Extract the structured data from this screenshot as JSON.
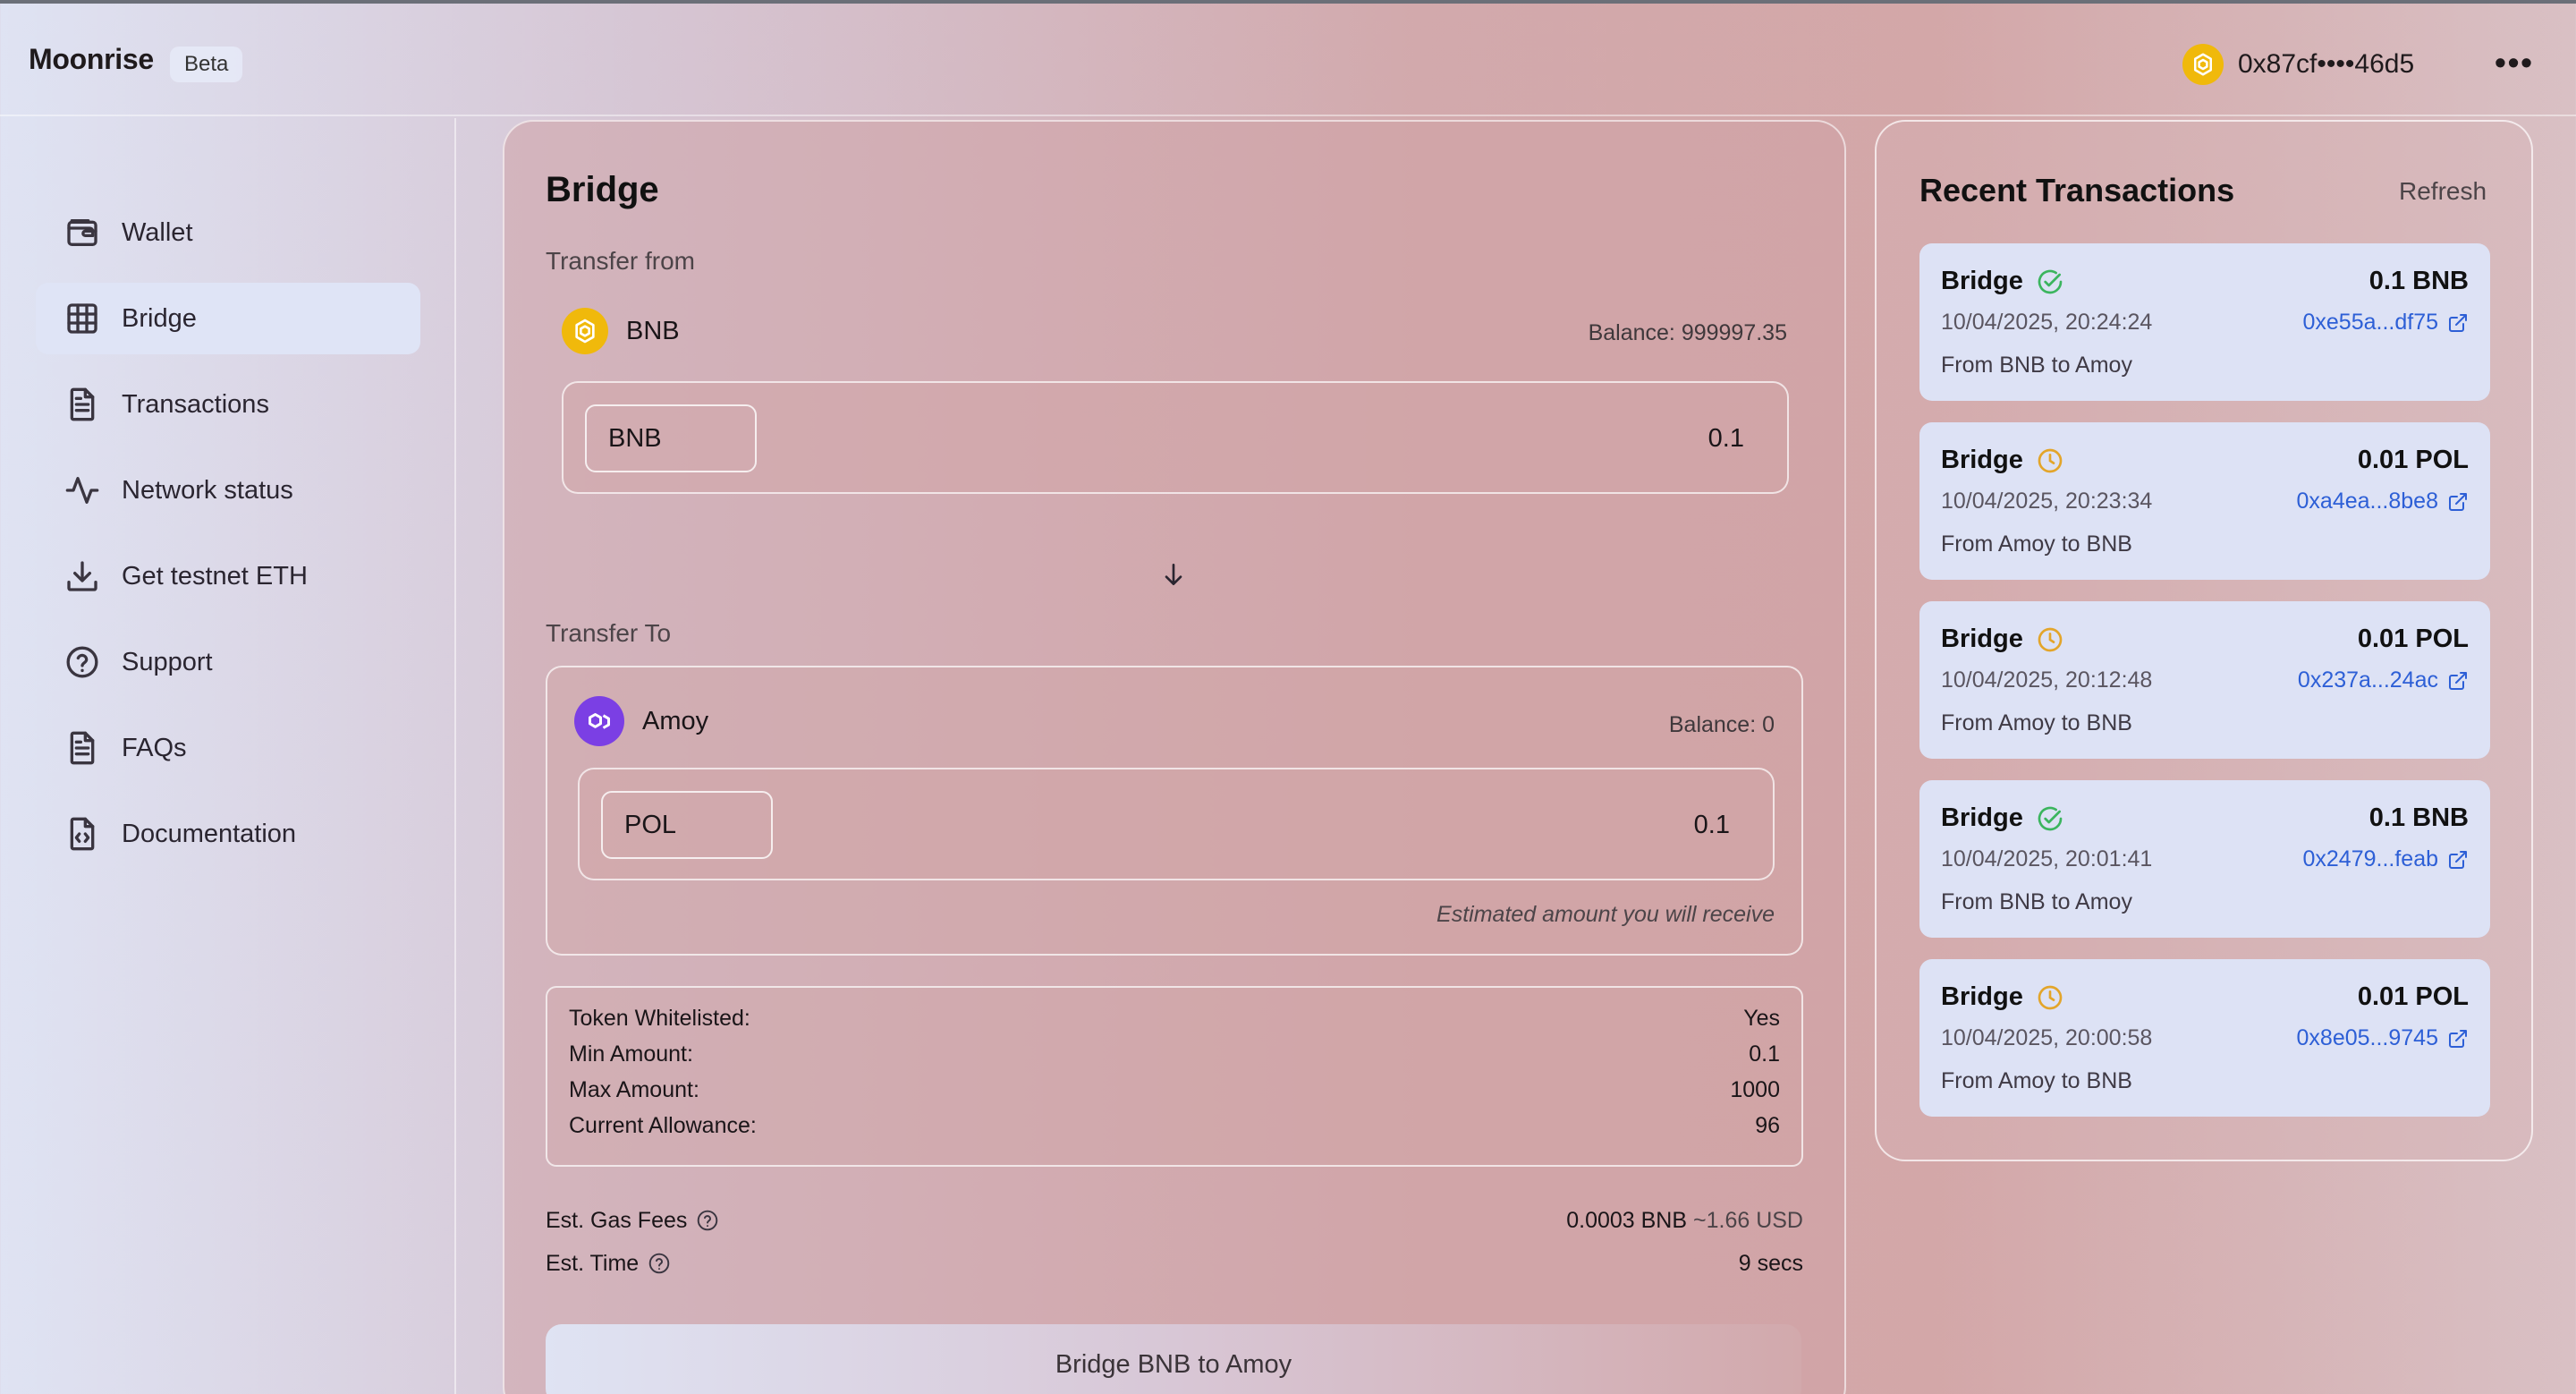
{
  "app": {
    "brand": "Moonrise",
    "badge": "Beta",
    "wallet_address": "0x87cf••••46d5",
    "menu_label": "•••"
  },
  "sidebar": {
    "items": [
      {
        "label": "Wallet",
        "icon": "wallet-icon"
      },
      {
        "label": "Bridge",
        "icon": "grid-icon",
        "active": true
      },
      {
        "label": "Transactions",
        "icon": "document-icon"
      },
      {
        "label": "Network status",
        "icon": "activity-icon"
      },
      {
        "label": "Get testnet ETH",
        "icon": "download-icon"
      },
      {
        "label": "Support",
        "icon": "help-circle-icon"
      },
      {
        "label": "FAQs",
        "icon": "document-icon"
      },
      {
        "label": "Documentation",
        "icon": "code-document-icon"
      }
    ]
  },
  "bridge": {
    "title": "Bridge",
    "from_label": "Transfer from",
    "from_chain": "BNB",
    "from_balance": "Balance: 999997.35",
    "from_token": "BNB",
    "from_amount": "0.1",
    "to_label": "Transfer To",
    "to_chain": "Amoy",
    "to_balance": "Balance: 0",
    "to_token": "POL",
    "to_amount": "0.1",
    "estimate_note": "Estimated amount you will receive",
    "info": [
      {
        "label": "Token Whitelisted:",
        "value": "Yes"
      },
      {
        "label": "Min Amount:",
        "value": "0.1"
      },
      {
        "label": "Max Amount:",
        "value": "1000"
      },
      {
        "label": "Current Allowance:",
        "value": "96"
      }
    ],
    "gas_label": "Est. Gas Fees",
    "gas_value": "0.0003 BNB",
    "gas_usd": "~1.66 USD",
    "time_label": "Est. Time",
    "time_value": "9 secs",
    "button_label": "Bridge BNB to Amoy"
  },
  "recent": {
    "title": "Recent Transactions",
    "refresh_label": "Refresh",
    "transactions": [
      {
        "type": "Bridge",
        "status": "success",
        "amount": "0.1 BNB",
        "time": "10/04/2025, 20:24:24",
        "hash": "0xe55a...df75",
        "route": "From BNB to Amoy"
      },
      {
        "type": "Bridge",
        "status": "pending",
        "amount": "0.01 POL",
        "time": "10/04/2025, 20:23:34",
        "hash": "0xa4ea...8be8",
        "route": "From Amoy to BNB"
      },
      {
        "type": "Bridge",
        "status": "pending",
        "amount": "0.01 POL",
        "time": "10/04/2025, 20:12:48",
        "hash": "0x237a...24ac",
        "route": "From Amoy to BNB"
      },
      {
        "type": "Bridge",
        "status": "success",
        "amount": "0.1 BNB",
        "time": "10/04/2025, 20:01:41",
        "hash": "0x2479...feab",
        "route": "From BNB to Amoy"
      },
      {
        "type": "Bridge",
        "status": "pending",
        "amount": "0.01 POL",
        "time": "10/04/2025, 20:00:58",
        "hash": "0x8e05...9745",
        "route": "From Amoy to BNB"
      }
    ]
  },
  "colors": {
    "success": "#3bb55e",
    "pending": "#e3a52a",
    "link": "#2d5fd6",
    "bnb": "#f0b90b",
    "amoy": "#7b3fe4"
  }
}
